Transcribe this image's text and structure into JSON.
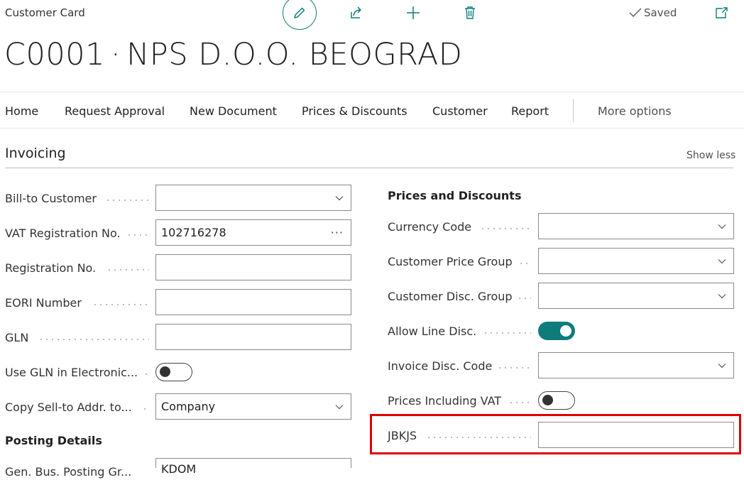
{
  "header": {
    "breadcrumb": "Customer Card",
    "saved_label": "Saved",
    "title_code": "C0001",
    "title_separator": "·",
    "title_name": "NPS D.O.O. BEOGRAD"
  },
  "actions": {
    "home": "Home",
    "request_approval": "Request Approval",
    "new_document": "New Document",
    "prices_discounts": "Prices & Discounts",
    "customer": "Customer",
    "report": "Report",
    "more_options": "More options"
  },
  "section": {
    "title": "Invoicing",
    "show_less": "Show less"
  },
  "left_fields": {
    "bill_to_customer": {
      "label": "Bill-to Customer",
      "value": ""
    },
    "vat_registration": {
      "label": "VAT Registration No.",
      "value": "102716278"
    },
    "registration_no": {
      "label": "Registration No.",
      "value": ""
    },
    "eori_number": {
      "label": "EORI Number",
      "value": ""
    },
    "gln": {
      "label": "GLN",
      "value": ""
    },
    "use_gln": {
      "label": "Use GLN in Electronic...",
      "value": "off"
    },
    "copy_sell_to": {
      "label": "Copy Sell-to Addr. to...",
      "value": "Company"
    },
    "posting_details": "Posting Details",
    "gen_bus_posting": {
      "label": "Gen. Bus. Posting Gr...",
      "value": "KDOM"
    }
  },
  "right_fields": {
    "prices_discounts_heading": "Prices and Discounts",
    "currency_code": {
      "label": "Currency Code",
      "value": ""
    },
    "customer_price_group": {
      "label": "Customer Price Group",
      "value": ""
    },
    "customer_disc_group": {
      "label": "Customer Disc. Group",
      "value": ""
    },
    "allow_line_disc": {
      "label": "Allow Line Disc.",
      "value": "on"
    },
    "invoice_disc_code": {
      "label": "Invoice Disc. Code",
      "value": ""
    },
    "prices_including_vat": {
      "label": "Prices Including VAT",
      "value": "off"
    },
    "jbkjs": {
      "label": "JBKJS",
      "value": ""
    }
  },
  "colors": {
    "accent": "#0f7b7b",
    "highlight": "#e00000"
  }
}
